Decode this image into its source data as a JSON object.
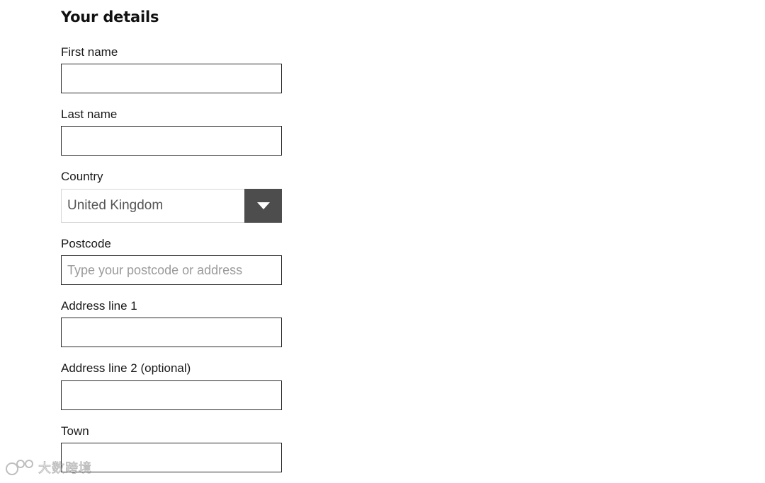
{
  "section": {
    "title": "Your details"
  },
  "fields": {
    "first_name": {
      "label": "First name",
      "value": "",
      "placeholder": ""
    },
    "last_name": {
      "label": "Last name",
      "value": "",
      "placeholder": ""
    },
    "country": {
      "label": "Country",
      "value": "United Kingdom",
      "icon": "chevron-down-icon"
    },
    "postcode": {
      "label": "Postcode",
      "value": "",
      "placeholder": "Type your postcode or address"
    },
    "address_line_1": {
      "label": "Address line 1",
      "value": "",
      "placeholder": ""
    },
    "address_line_2": {
      "label": "Address line 2 (optional)",
      "value": "",
      "placeholder": ""
    },
    "town": {
      "label": "Town",
      "value": "",
      "placeholder": ""
    }
  },
  "watermark": {
    "text": "大数跨境"
  },
  "colors": {
    "input_border": "#2a2a2a",
    "select_border": "#d6d6d6",
    "select_button": "#4d4d4d",
    "placeholder": "#9a9a9a"
  }
}
